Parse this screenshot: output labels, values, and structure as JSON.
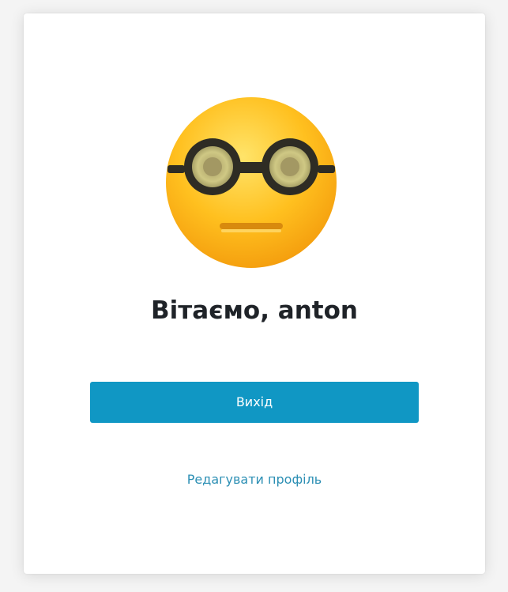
{
  "profile": {
    "greeting": "Вітаємо, anton",
    "avatar_icon": "sunglasses-emoji-icon"
  },
  "actions": {
    "logout_label": "Вихід",
    "edit_profile_label": "Редагувати профіль"
  },
  "colors": {
    "primary": "#1097c4",
    "link": "#2c8fb4",
    "text": "#1f2328"
  }
}
